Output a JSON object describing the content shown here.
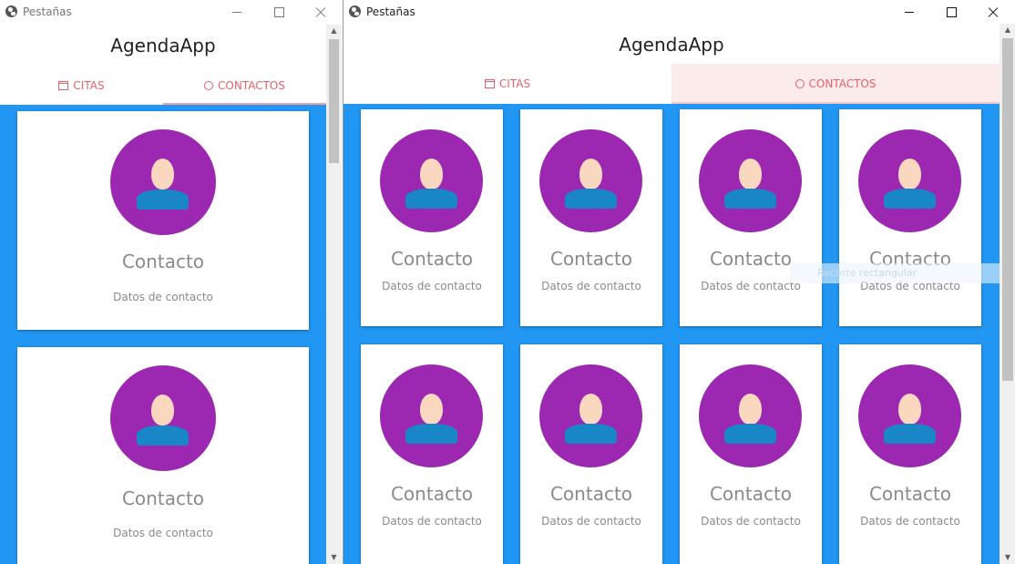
{
  "left_window": {
    "title": "Pestañas",
    "app_title": "AgendaApp",
    "tabs": [
      {
        "label": "CITAS",
        "icon": "calendar-icon",
        "active": false
      },
      {
        "label": "CONTACTOS",
        "icon": "face-icon",
        "active": true
      }
    ],
    "cards": [
      {
        "title": "Contacto",
        "subtitle": "Datos de contacto"
      },
      {
        "title": "Contacto",
        "subtitle": "Datos de contacto"
      }
    ]
  },
  "right_window": {
    "title": "Pestañas",
    "app_title": "AgendaApp",
    "tabs": [
      {
        "label": "CITAS",
        "icon": "calendar-icon",
        "active": false
      },
      {
        "label": "CONTACTOS",
        "icon": "face-icon",
        "active": true
      }
    ],
    "cards": [
      {
        "title": "Contacto",
        "subtitle": "Datos de contacto"
      },
      {
        "title": "Contacto",
        "subtitle": "Datos de contacto"
      },
      {
        "title": "Contacto",
        "subtitle": "Datos de contacto"
      },
      {
        "title": "Contacto",
        "subtitle": "Datos de contacto"
      },
      {
        "title": "Contacto",
        "subtitle": "Datos de contacto"
      },
      {
        "title": "Contacto",
        "subtitle": "Datos de contacto"
      },
      {
        "title": "Contacto",
        "subtitle": "Datos de contacto"
      },
      {
        "title": "Contacto",
        "subtitle": "Datos de contacto"
      }
    ],
    "overlay_hint": "Recorte rectangular"
  },
  "colors": {
    "content_background": "#2196f3",
    "avatar_background": "#9c27b0",
    "avatar_head": "#fad7bf",
    "avatar_body": "#1987c7",
    "tab_text": "#e8606b",
    "active_tab_background": "#fbeceb"
  }
}
